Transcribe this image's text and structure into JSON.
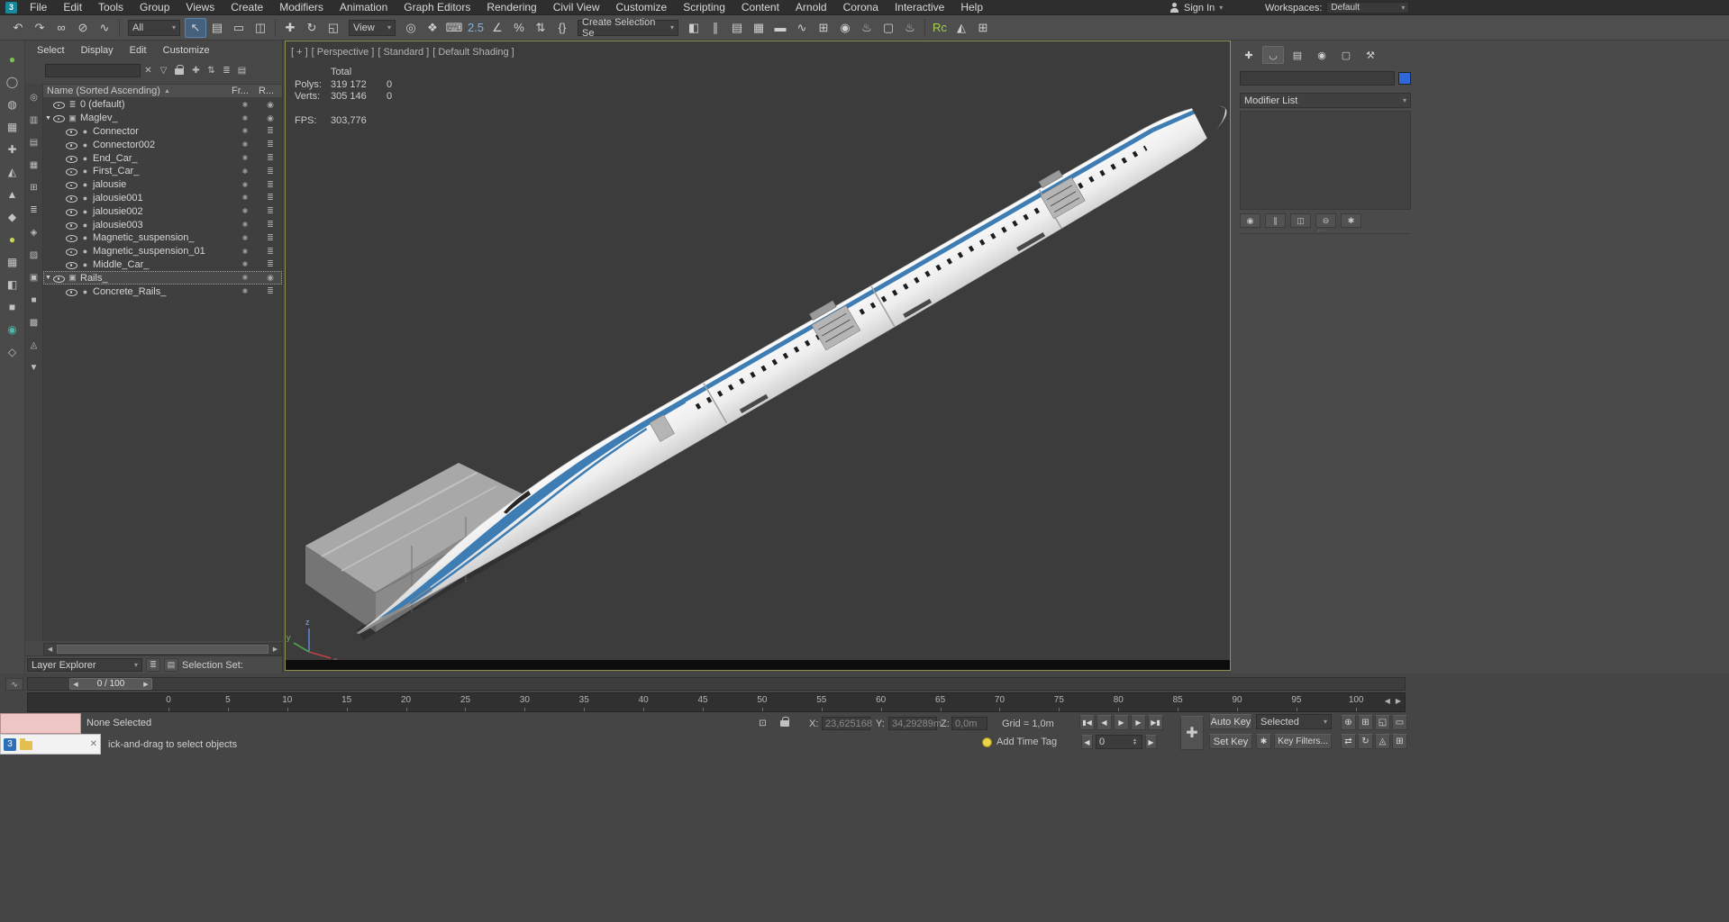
{
  "menu_bar": {
    "logo_glyph": "3",
    "items": [
      "File",
      "Edit",
      "Tools",
      "Group",
      "Views",
      "Create",
      "Modifiers",
      "Animation",
      "Graph Editors",
      "Rendering",
      "Civil View",
      "Customize",
      "Scripting",
      "Content",
      "Arnold",
      "Corona",
      "Interactive",
      "Help"
    ],
    "sign_in_label": "Sign In",
    "sign_in_arrow": "▾",
    "workspaces_label": "Workspaces:",
    "workspace_value": "Default",
    "workspace_arrow": "▾"
  },
  "toolbar": {
    "icons_a": [
      {
        "name": "undo-icon",
        "glyph": "↶"
      },
      {
        "name": "redo-icon",
        "glyph": "↷"
      },
      {
        "name": "select-and-link-icon",
        "glyph": "∞"
      },
      {
        "name": "unlink-selection-icon",
        "glyph": "⊘"
      },
      {
        "name": "bind-to-space-warp-icon",
        "glyph": "∿"
      }
    ],
    "filter_value": "All",
    "filter_arrow": "▾",
    "icons_b": [
      {
        "name": "select-object-icon",
        "glyph": "↖",
        "active": true
      },
      {
        "name": "select-by-name-icon",
        "glyph": "▤"
      },
      {
        "name": "rectangular-selection-region-icon",
        "glyph": "▭"
      },
      {
        "name": "window-crossing-icon",
        "glyph": "◫"
      }
    ],
    "icons_c": [
      {
        "name": "select-and-move-icon",
        "glyph": "✚"
      },
      {
        "name": "select-and-rotate-icon",
        "glyph": "↻"
      },
      {
        "name": "select-and-scale-icon",
        "glyph": "◱"
      }
    ],
    "coord_value": "View",
    "coord_arrow": "▾",
    "icons_d": [
      {
        "name": "use-pivot-point-center-icon",
        "glyph": "◎"
      },
      {
        "name": "select-and-manipulate-icon",
        "glyph": "❖"
      },
      {
        "name": "keyboard-shortcut-override-icon",
        "glyph": "⌨"
      },
      {
        "name": "snaps-toggle-icon",
        "glyph": "2.5",
        "color": "#7fb2e0"
      },
      {
        "name": "angle-snap-icon",
        "glyph": "∠"
      },
      {
        "name": "percent-snap-icon",
        "glyph": "%"
      },
      {
        "name": "spinner-snap-icon",
        "glyph": "⇅"
      },
      {
        "name": "edit-named-selection-sets-icon",
        "glyph": "{}"
      }
    ],
    "selection_set_value": "Create Selection Se",
    "selection_set_arrow": "▾",
    "icons_e": [
      {
        "name": "mirror-icon",
        "glyph": "◧"
      },
      {
        "name": "align-icon",
        "glyph": "∥"
      },
      {
        "name": "toggle-scene-explorer-icon",
        "glyph": "▤"
      },
      {
        "name": "toggle-layer-explorer-icon",
        "glyph": "▦"
      },
      {
        "name": "toggle-ribbon-icon",
        "glyph": "▬"
      },
      {
        "name": "curve-editor-icon",
        "glyph": "∿"
      },
      {
        "name": "schematic-view-icon",
        "glyph": "⊞"
      },
      {
        "name": "material-editor-icon",
        "glyph": "◉"
      },
      {
        "name": "render-setup-icon",
        "glyph": "♨"
      },
      {
        "name": "rendered-frame-window-icon",
        "glyph": "▢"
      },
      {
        "name": "render-production-icon",
        "glyph": "♨"
      }
    ],
    "icons_f": [
      {
        "name": "render-corona-icon",
        "glyph": "Rc",
        "color": "#9fd24f"
      },
      {
        "name": "render-arnold-icon",
        "glyph": "◭"
      },
      {
        "name": "uv-editor-icon",
        "glyph": "⊞"
      }
    ]
  },
  "left_toolbar": {
    "icons": [
      {
        "name": "left-tool-1",
        "glyph": "●",
        "color": "#7cc24a"
      },
      {
        "name": "left-tool-2",
        "glyph": "◯"
      },
      {
        "name": "left-tool-3",
        "glyph": "◍"
      },
      {
        "name": "left-tool-4",
        "glyph": "▦"
      },
      {
        "name": "left-tool-5",
        "glyph": "✚"
      },
      {
        "name": "left-tool-6",
        "glyph": "◭"
      },
      {
        "name": "left-tool-7",
        "glyph": "▲"
      },
      {
        "name": "left-tool-8",
        "glyph": "◆"
      },
      {
        "name": "left-tool-9",
        "glyph": "●",
        "color": "#c9d64f"
      },
      {
        "name": "left-tool-10",
        "glyph": "▦"
      },
      {
        "name": "left-tool-11",
        "glyph": "◧"
      },
      {
        "name": "left-tool-12",
        "glyph": "■"
      },
      {
        "name": "left-tool-13",
        "glyph": "◉",
        "color": "#49b8a8"
      },
      {
        "name": "left-tool-14",
        "glyph": "◇"
      }
    ]
  },
  "scene_explorer": {
    "menu_items": [
      "Select",
      "Display",
      "Edit",
      "Customize"
    ],
    "search_placeholder": "",
    "icons": {
      "clear": "✕",
      "filter": "▽",
      "add": "✚",
      "sort": "⇅",
      "list": "≣",
      "cols": "▤"
    },
    "tools": [
      {
        "name": "explorer-tool-1",
        "glyph": "◎"
      },
      {
        "name": "explorer-tool-2",
        "glyph": "▥"
      },
      {
        "name": "explorer-tool-3",
        "glyph": "▤"
      },
      {
        "name": "explorer-tool-4",
        "glyph": "▦"
      },
      {
        "name": "explorer-tool-5",
        "glyph": "⊞"
      },
      {
        "name": "explorer-tool-6",
        "glyph": "≣"
      },
      {
        "name": "explorer-tool-7",
        "glyph": "◈"
      },
      {
        "name": "explorer-tool-8",
        "glyph": "▨"
      },
      {
        "name": "explorer-tool-9",
        "glyph": "▣"
      },
      {
        "name": "explorer-tool-10",
        "glyph": "■"
      },
      {
        "name": "explorer-tool-11",
        "glyph": "▩"
      },
      {
        "name": "explorer-tool-12",
        "glyph": "◬"
      },
      {
        "name": "explorer-tool-13",
        "glyph": "▼"
      }
    ],
    "header": {
      "name_label": "Name (Sorted Ascending)",
      "sort_arrow": "▲",
      "frozen_label": "Fr...",
      "render_label": "R..."
    },
    "rows": [
      {
        "label": "0 (default)",
        "expander": "",
        "type_glyph": "≣",
        "indent": 0,
        "fr": "✱",
        "r": "◉"
      },
      {
        "label": "Maglev_",
        "expander": "▼",
        "type_glyph": "▣",
        "indent": 0,
        "fr": "✱",
        "r": "◉"
      },
      {
        "label": "Connector",
        "expander": "",
        "type_glyph": "●",
        "indent": 1,
        "fr": "✱",
        "r": "≣"
      },
      {
        "label": "Connector002",
        "expander": "",
        "type_glyph": "●",
        "indent": 1,
        "fr": "✱",
        "r": "≣"
      },
      {
        "label": "End_Car_",
        "expander": "",
        "type_glyph": "●",
        "indent": 1,
        "fr": "✱",
        "r": "≣"
      },
      {
        "label": "First_Car_",
        "expander": "",
        "type_glyph": "●",
        "indent": 1,
        "fr": "✱",
        "r": "≣"
      },
      {
        "label": "jalousie",
        "expander": "",
        "type_glyph": "●",
        "indent": 1,
        "fr": "✱",
        "r": "≣"
      },
      {
        "label": "jalousie001",
        "expander": "",
        "type_glyph": "●",
        "indent": 1,
        "fr": "✱",
        "r": "≣"
      },
      {
        "label": "jalousie002",
        "expander": "",
        "type_glyph": "●",
        "indent": 1,
        "fr": "✱",
        "r": "≣"
      },
      {
        "label": "jalousie003",
        "expander": "",
        "type_glyph": "●",
        "indent": 1,
        "fr": "✱",
        "r": "≣"
      },
      {
        "label": "Magnetic_suspension_",
        "expander": "",
        "type_glyph": "●",
        "indent": 1,
        "fr": "✱",
        "r": "≣"
      },
      {
        "label": "Magnetic_suspension_01",
        "expander": "",
        "type_glyph": "●",
        "indent": 1,
        "fr": "✱",
        "r": "≣"
      },
      {
        "label": "Middle_Car_",
        "expander": "",
        "type_glyph": "●",
        "indent": 1,
        "fr": "✱",
        "r": "≣"
      },
      {
        "label": "Rails_",
        "expander": "▼",
        "type_glyph": "▣",
        "indent": 0,
        "fr": "✱",
        "r": "◉",
        "selected": true
      },
      {
        "label": "Concrete_Rails_",
        "expander": "",
        "type_glyph": "●",
        "indent": 1,
        "fr": "✱",
        "r": "≣"
      }
    ],
    "footer": {
      "mode_value": "Layer Explorer",
      "mode_arrow": "▾",
      "selection_set_label": "Selection Set:"
    }
  },
  "viewport": {
    "label_general": "[ + ]",
    "label_pov": "[ Perspective ]",
    "label_style": "[ Standard ]",
    "label_shading": "[ Default Shading ]",
    "stats": {
      "total_label": "Total",
      "polys_label": "Polys:",
      "polys_value": "319 172",
      "polys_delta": "0",
      "verts_label": "Verts:",
      "verts_value": "305 146",
      "verts_delta": "0",
      "fps_label": "FPS:",
      "fps_value": "303,776"
    },
    "axis": {
      "x_label": "x",
      "y_label": "y",
      "z_label": "z"
    },
    "train": {
      "body_color": "#f2f2f2",
      "stripe_color": "#3e7db3",
      "deck_color": "#a8a8a8",
      "wall_color": "#8a8a8a",
      "end_color": "#757575",
      "tip_color": "#3c3c3c"
    }
  },
  "command_panel": {
    "tabs": [
      {
        "name": "tab-create",
        "glyph": "✚"
      },
      {
        "name": "tab-modify",
        "glyph": "◡",
        "active": true
      },
      {
        "name": "tab-hierarchy",
        "glyph": "▤"
      },
      {
        "name": "tab-motion",
        "glyph": "◉"
      },
      {
        "name": "tab-display",
        "glyph": "▢"
      },
      {
        "name": "tab-utilities",
        "glyph": "⚒"
      }
    ],
    "object_name_value": "",
    "swatch_color": "#2e68d9",
    "modifier_list_label": "Modifier List",
    "modifier_list_arrow": "▾",
    "stack_ops": [
      {
        "name": "pin-stack-button",
        "glyph": "◉"
      },
      {
        "name": "show-end-result-button",
        "glyph": "∥"
      },
      {
        "name": "make-unique-button",
        "glyph": "◫"
      },
      {
        "name": "remove-modifier-button",
        "glyph": "⊖"
      },
      {
        "name": "configure-modifier-sets-button",
        "glyph": "✱"
      }
    ]
  },
  "timeline": {
    "slider_value": "0 / 100",
    "slider_left_arrow": "◀",
    "slider_right_arrow": "▶",
    "ticks": [
      "0",
      "5",
      "10",
      "15",
      "20",
      "25",
      "30",
      "35",
      "40",
      "45",
      "50",
      "55",
      "60",
      "65",
      "70",
      "75",
      "80",
      "85",
      "90",
      "95",
      "100"
    ]
  },
  "status_bar": {
    "selection_status": "None Selected",
    "prompt": "ick-and-drag to select objects",
    "listener_close": "✕",
    "taskbar_badge": "3",
    "x_label": "X:",
    "x_value": "23,625168",
    "y_label": "Y:",
    "y_value": "34,29289m",
    "z_label": "Z:",
    "z_value": "0,0m",
    "grid_label": "Grid = 1,0m",
    "add_time_tag_label": "Add Time Tag",
    "auto_key_label": "Auto Key",
    "set_key_label": "Set Key",
    "selected_value": "Selected",
    "key_filters_label": "Key Filters...",
    "frame_value": "0",
    "big_key_glyph": "✚",
    "key_mode_glyph": "✱",
    "transport": [
      {
        "name": "go-to-start-button",
        "glyph": "▮◀"
      },
      {
        "name": "previous-frame-button",
        "glyph": "◀"
      },
      {
        "name": "play-button",
        "glyph": "▶"
      },
      {
        "name": "next-frame-button",
        "glyph": "▶"
      },
      {
        "name": "go-to-end-button",
        "glyph": "▶▮"
      }
    ],
    "nav_icons_row1": [
      {
        "name": "zoom-icon",
        "glyph": "⊕"
      },
      {
        "name": "zoom-all-icon",
        "glyph": "⊞"
      },
      {
        "name": "zoom-extents-icon",
        "glyph": "◱"
      },
      {
        "name": "zoom-region-icon",
        "glyph": "▭"
      }
    ],
    "nav_icons_row2": [
      {
        "name": "pan-icon",
        "glyph": "⇄"
      },
      {
        "name": "orbit-icon",
        "glyph": "↻"
      },
      {
        "name": "field-of-view-icon",
        "glyph": "◬"
      },
      {
        "name": "maximize-viewport-toggle",
        "glyph": "⊞"
      }
    ]
  }
}
